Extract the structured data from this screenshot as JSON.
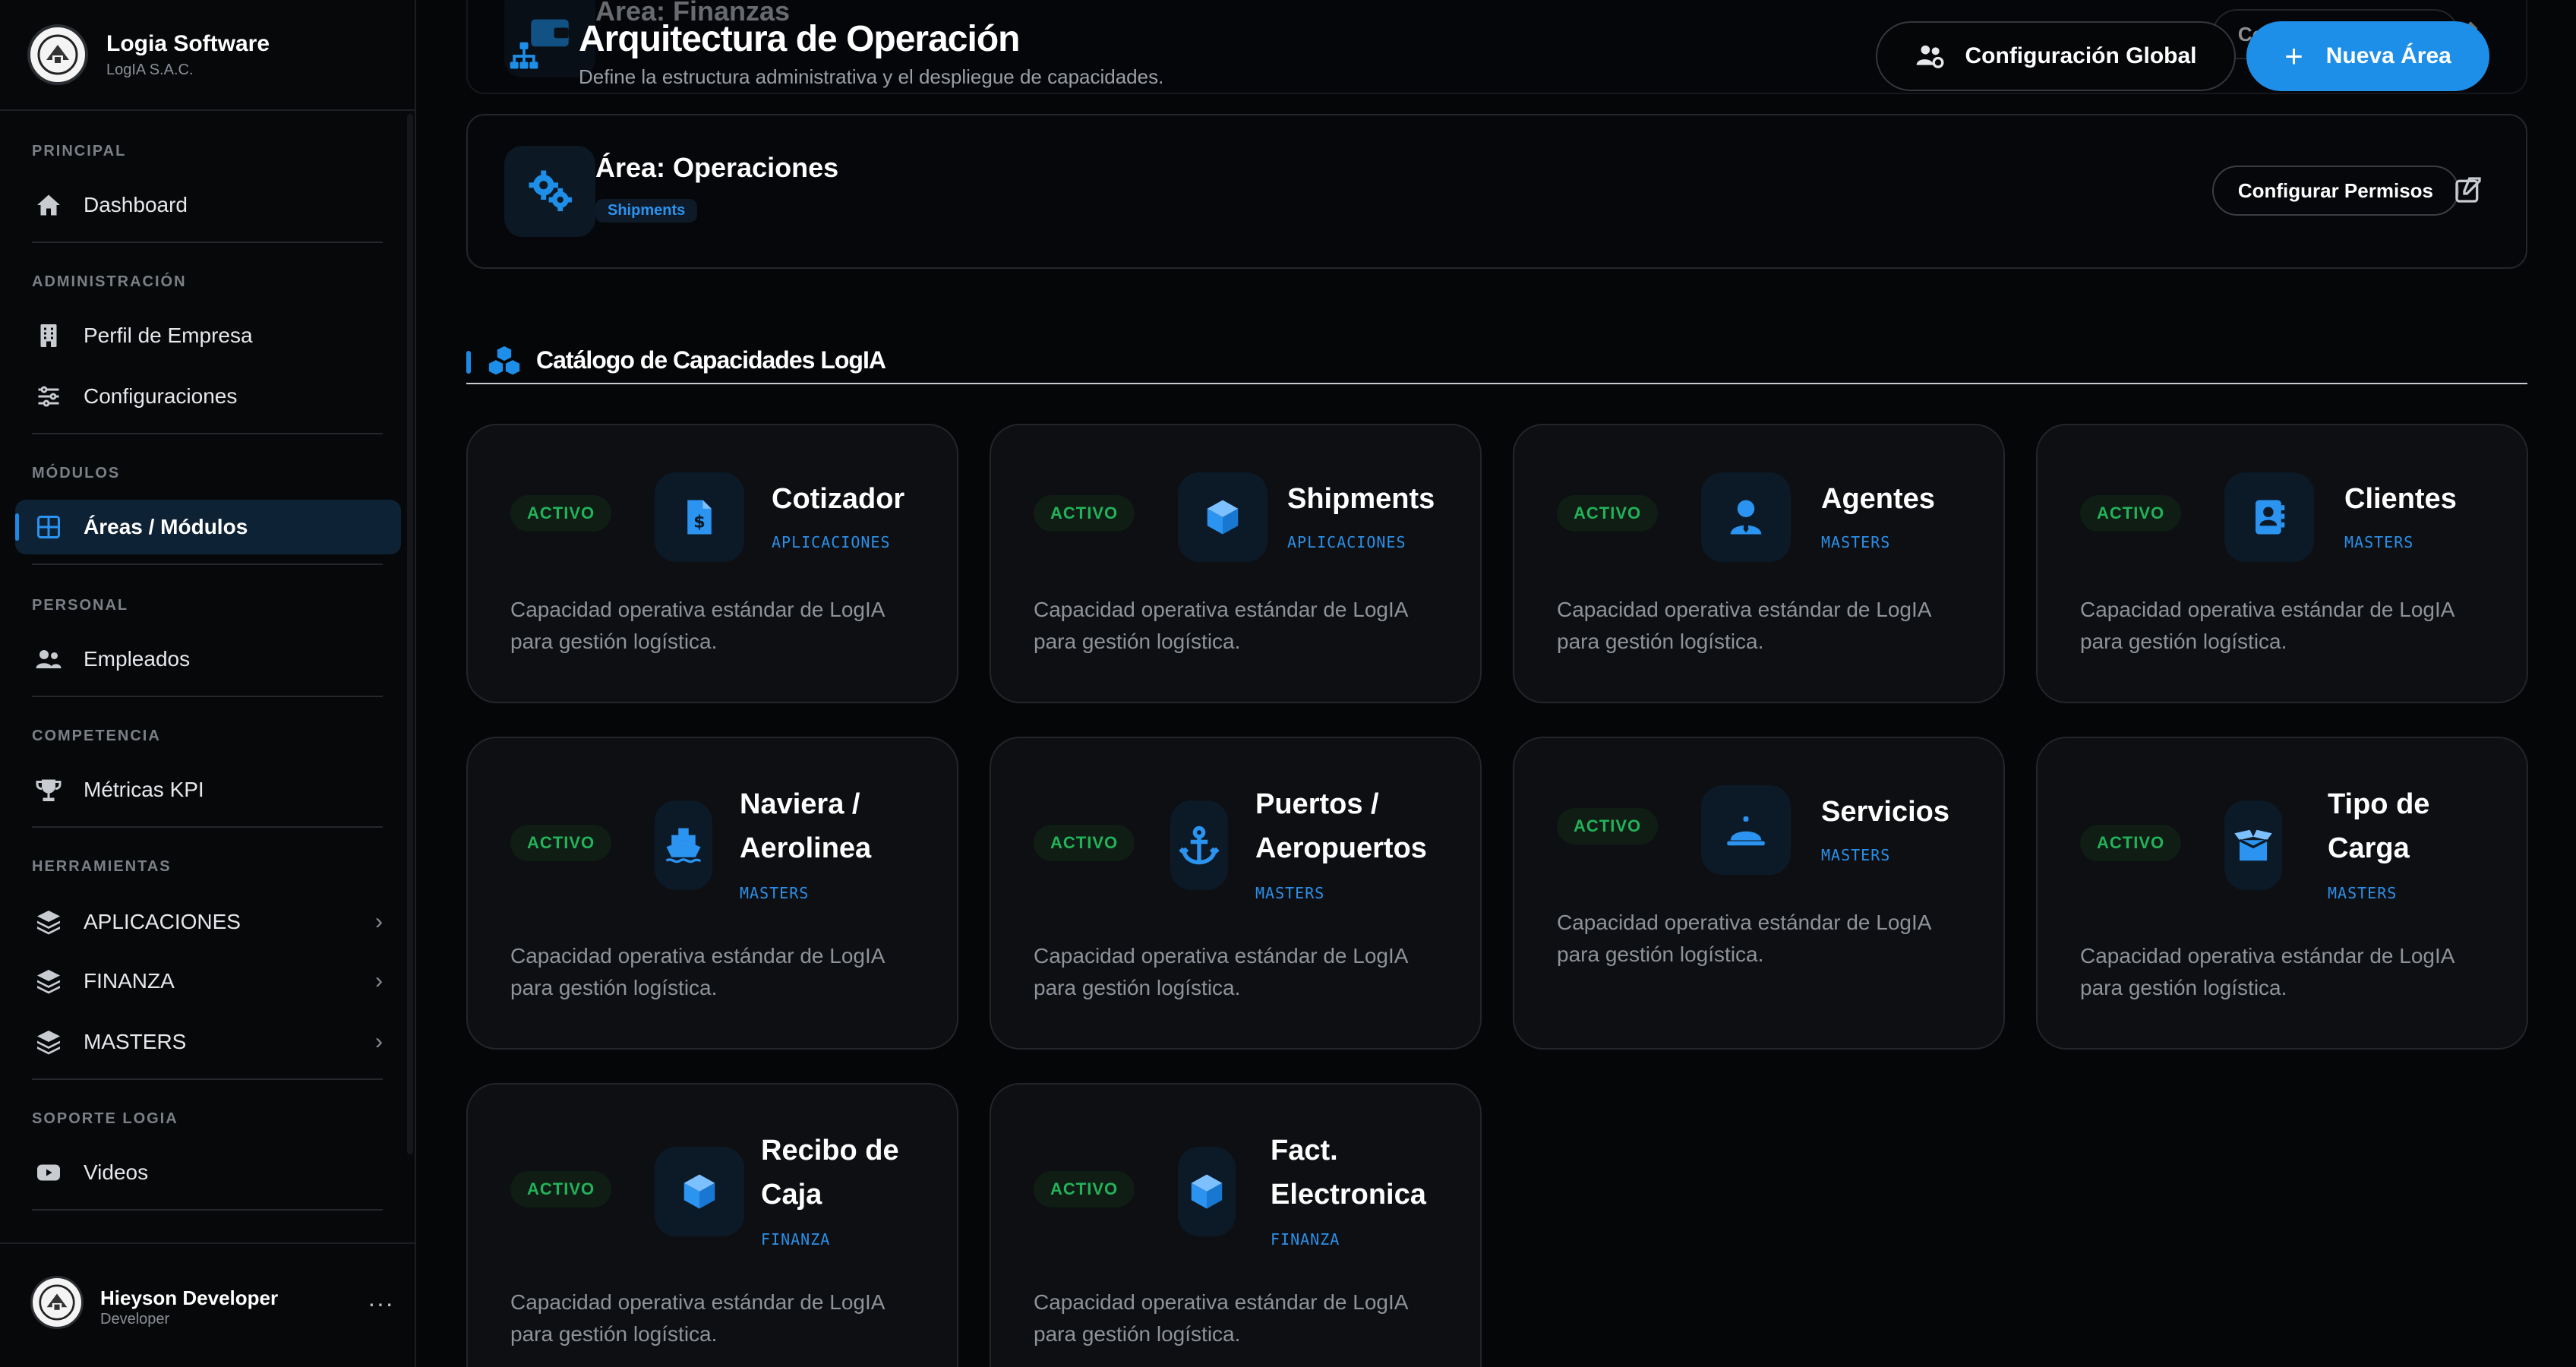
{
  "brand": {
    "name": "Logia Software",
    "sub": "LogIA S.A.C."
  },
  "sidebar": {
    "sections": [
      {
        "label": "PRINCIPAL"
      },
      {
        "label": "ADMINISTRACIÓN"
      },
      {
        "label": "MÓDULOS"
      },
      {
        "label": "PERSONAL"
      },
      {
        "label": "COMPETENCIA"
      },
      {
        "label": "HERRAMIENTAS"
      },
      {
        "label": "SOPORTE LOGIA"
      }
    ],
    "items": [
      {
        "label": "Dashboard",
        "icon": "home-icon"
      },
      {
        "label": "Perfil de Empresa",
        "icon": "building-icon"
      },
      {
        "label": "Configuraciones",
        "icon": "sliders-icon"
      },
      {
        "label": "Áreas / Módulos",
        "icon": "grid-icon",
        "active": true
      },
      {
        "label": "Empleados",
        "icon": "users-icon"
      },
      {
        "label": "Métricas KPI",
        "icon": "trophy-icon"
      },
      {
        "label": "APLICACIONES",
        "icon": "layers-icon"
      },
      {
        "label": "FINANZA",
        "icon": "layers-icon"
      },
      {
        "label": "MASTERS",
        "icon": "layers-icon"
      },
      {
        "label": "Videos",
        "icon": "youtube-icon"
      }
    ]
  },
  "user": {
    "name": "Hieyson Developer",
    "role": "Developer",
    "more": "···"
  },
  "header": {
    "title": "Arquitectura de Operación",
    "subtitle": "Define la estructura administrativa y el despliegue de capacidades.",
    "global_button": "Configuración Global",
    "new_button": "Nueva Área",
    "new_plus": "+"
  },
  "areas": [
    {
      "title": "Área: Finanzas",
      "permissions_button": "Configurar Permisos"
    },
    {
      "title": "Área: Operaciones",
      "tag": "Shipments",
      "permissions_button": "Configurar Permisos"
    }
  ],
  "catalog": {
    "title": "Catálogo de Capacidades LogIA",
    "status_label": "ACTIVO",
    "description_line1": "Capacidad operativa estándar de LogIA",
    "description_line2": "para gestión logística.",
    "cards": [
      {
        "title": "Cotizador",
        "title2": "",
        "category": "APLICACIONES",
        "icon": "dollar-file-icon"
      },
      {
        "title": "Shipments",
        "title2": "",
        "category": "APLICACIONES",
        "icon": "cube-icon"
      },
      {
        "title": "Agentes",
        "title2": "",
        "category": "MASTERS",
        "icon": "user-tie-icon"
      },
      {
        "title": "Clientes",
        "title2": "",
        "category": "MASTERS",
        "icon": "address-book-icon"
      },
      {
        "title": "Naviera /",
        "title2": "Aerolinea",
        "category": "MASTERS",
        "icon": "ship-icon"
      },
      {
        "title": "Puertos /",
        "title2": "Aeropuertos",
        "category": "MASTERS",
        "icon": "anchor-icon"
      },
      {
        "title": "Servicios",
        "title2": "",
        "category": "MASTERS",
        "icon": "bell-service-icon"
      },
      {
        "title": "Tipo de",
        "title2": "Carga",
        "category": "MASTERS",
        "icon": "box-open-icon"
      },
      {
        "title": "Recibo de",
        "title2": "Caja",
        "category": "FINANZA",
        "icon": "cube-icon"
      },
      {
        "title": "Fact.",
        "title2": "Electronica",
        "category": "FINANZA",
        "icon": "cube-icon"
      }
    ]
  },
  "colors": {
    "accent": "#1e8fe8",
    "active_badge": "#22b35a",
    "background": "#050608"
  }
}
